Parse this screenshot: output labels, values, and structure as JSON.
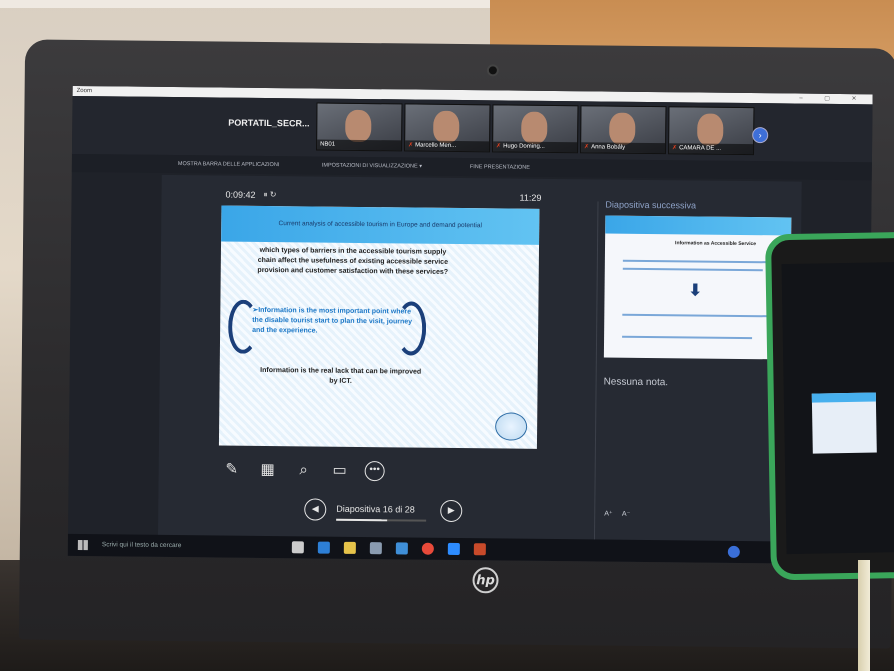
{
  "zoom": {
    "window_title": "Zoom",
    "host_name": "PORTATIL_SECR...",
    "participants": [
      {
        "name": "NB01"
      },
      {
        "name": "Marcello Men..."
      },
      {
        "name": "Hugo Doming..."
      },
      {
        "name": "Anna Bobály"
      },
      {
        "name": "CAMARA DE ..."
      }
    ],
    "next_icon": "chevron-right-icon"
  },
  "presenter_toolbar": {
    "show_taskbar": "MOSTRA BARRA DELLE APPLICAZIONI",
    "display_settings": "IMPOSTAZIONI DI VISUALIZZAZIONE ▾",
    "end_presentation": "FINE PRESENTAZIONE"
  },
  "presenter": {
    "timer": "0:09:42",
    "pause_icon": "⏸",
    "reset_icon": "↻",
    "clock": "11:29",
    "current_slide": {
      "header": "Current analysis of accessible tourism in Europe and demand potential",
      "question": "which types of barriers in the accessible tourism supply chain affect the usefulness of existing accessible service provision and customer satisfaction with these services?",
      "point": "➢Information is the most important point where the disable tourist start to plan the visit, journey and the experience.",
      "conclusion": "Information is the real lack that can be improved by ICT."
    },
    "tools": [
      "pen-icon",
      "slides-grid-icon",
      "zoom-icon",
      "screen-icon",
      "more-icon"
    ],
    "navigation": {
      "label": "Diapositiva 16 di 28",
      "progress": 0.57
    },
    "next_slide_label": "Diapositiva successiva",
    "next_slide_text": "Information as Accessible Service",
    "notes": "Nessuna nota.",
    "font_buttons": [
      "A⁺",
      "A⁻"
    ]
  },
  "taskbar": {
    "search_placeholder": "Scrivi qui il testo da cercare"
  },
  "colors": {
    "zoom_accent": "#3e6fd8",
    "slide_header": "#3aa6e8",
    "phone_case": "#3aa65a"
  }
}
